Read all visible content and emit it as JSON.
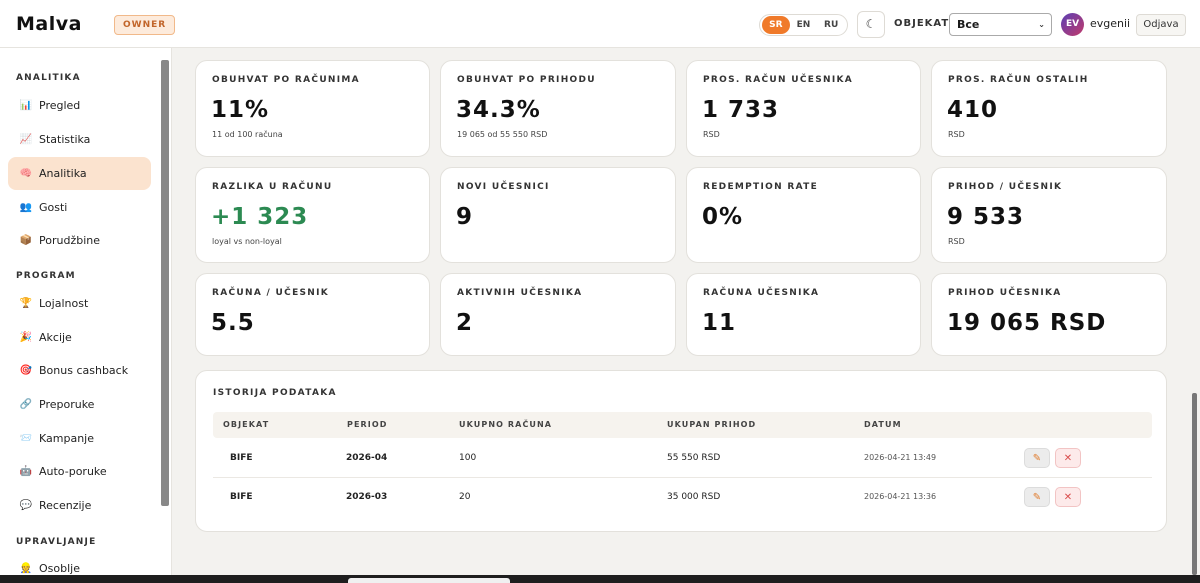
{
  "header": {
    "logo": "Malva",
    "role_badge": "OWNER",
    "languages": [
      {
        "code": "SR",
        "active": true
      },
      {
        "code": "EN",
        "active": false
      },
      {
        "code": "RU",
        "active": false
      }
    ],
    "theme_icon": "moon-icon",
    "objekat_label": "OBJEKAT",
    "objekat_selected": "Все",
    "avatar_initials": "EV",
    "username": "evgenii",
    "logout_label": "Odjava"
  },
  "sidebar": {
    "sections": [
      {
        "title": "ANALITIKA",
        "items": [
          {
            "label": "Pregled",
            "icon": "bar-chart-icon",
            "glyph": "📊"
          },
          {
            "label": "Statistika",
            "icon": "line-chart-icon",
            "glyph": "📈"
          },
          {
            "label": "Analitika",
            "icon": "brain-icon",
            "glyph": "🧠",
            "active": true
          },
          {
            "label": "Gosti",
            "icon": "people-icon",
            "glyph": "👥"
          },
          {
            "label": "Porudžbine",
            "icon": "package-icon",
            "glyph": "📦"
          }
        ]
      },
      {
        "title": "PROGRAM",
        "items": [
          {
            "label": "Lojalnost",
            "icon": "trophy-icon",
            "glyph": "🏆"
          },
          {
            "label": "Akcije",
            "icon": "party-icon",
            "glyph": "🎉"
          },
          {
            "label": "Bonus cashback",
            "icon": "target-icon",
            "glyph": "🎯"
          },
          {
            "label": "Preporuke",
            "icon": "link-icon",
            "glyph": "🔗"
          },
          {
            "label": "Kampanje",
            "icon": "mail-icon",
            "glyph": "📨"
          },
          {
            "label": "Auto-poruke",
            "icon": "robot-icon",
            "glyph": "🤖"
          },
          {
            "label": "Recenzije",
            "icon": "speech-bubble-icon",
            "glyph": "💬"
          }
        ]
      },
      {
        "title": "UPRAVLJANJE",
        "items": [
          {
            "label": "Osoblje",
            "icon": "staff-icon",
            "glyph": "👷"
          }
        ]
      }
    ]
  },
  "stats": [
    {
      "label": "OBUHVAT PO RAČUNIMA",
      "value": "11%",
      "sub": "11 od 100 računa"
    },
    {
      "label": "OBUHVAT PO PRIHODU",
      "value": "34.3%",
      "sub": "19 065 od 55 550 RSD"
    },
    {
      "label": "PROS. RAČUN UČESNIKA",
      "value": "1 733",
      "sub": "RSD"
    },
    {
      "label": "PROS. RAČUN OSTALIH",
      "value": "410",
      "sub": "RSD"
    },
    {
      "label": "RAZLIKA U RAČUNU",
      "value": "+1 323",
      "sub": "loyal vs non-loyal",
      "green": true
    },
    {
      "label": "NOVI UČESNICI",
      "value": "9",
      "sub": ""
    },
    {
      "label": "REDEMPTION RATE",
      "value": "0%",
      "sub": ""
    },
    {
      "label": "PRIHOD / UČESNIK",
      "value": "9 533",
      "sub": "RSD"
    },
    {
      "label": "RAČUNA / UČESNIK",
      "value": "5.5",
      "sub": ""
    },
    {
      "label": "AKTIVNIH UČESNIKA",
      "value": "2",
      "sub": ""
    },
    {
      "label": "RAČUNA UČESNIKA",
      "value": "11",
      "sub": ""
    },
    {
      "label": "PRIHOD UČESNIKA",
      "value": "19 065 RSD",
      "sub": ""
    }
  ],
  "history": {
    "title": "ISTORIJA PODATAKA",
    "columns": [
      "OBJEKAT",
      "PERIOD",
      "UKUPNO RAČUNA",
      "UKUPAN PRIHOD",
      "DATUM"
    ],
    "rows": [
      {
        "objekat": "BIFE",
        "period": "2026-04",
        "racuna": "100",
        "prihod": "55 550 RSD",
        "datum": "2026-04-21 13:49"
      },
      {
        "objekat": "BIFE",
        "period": "2026-03",
        "racuna": "20",
        "prihod": "35 000 RSD",
        "datum": "2026-04-21 13:36"
      }
    ],
    "edit_icon": "pencil-icon",
    "delete_icon": "close-icon"
  }
}
